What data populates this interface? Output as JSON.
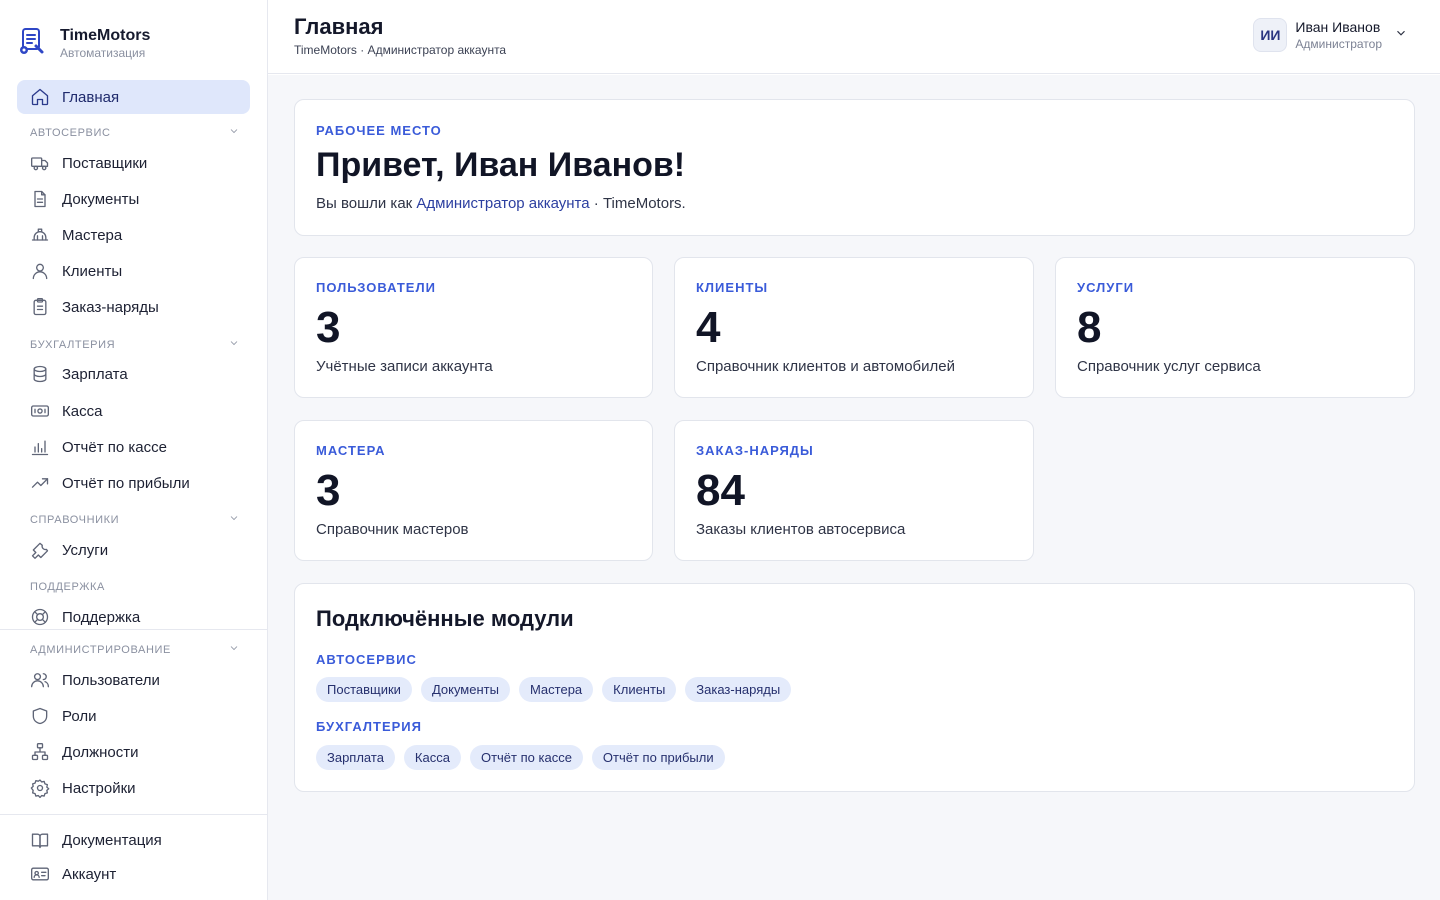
{
  "brand": {
    "title": "TimeMotors",
    "subtitle": "Автоматизация"
  },
  "sidebar": {
    "home": {
      "label": "Главная",
      "icon": "home-icon"
    },
    "sections": [
      {
        "label": "Автосервис",
        "items": [
          {
            "label": "Поставщики",
            "icon": "truck-icon"
          },
          {
            "label": "Документы",
            "icon": "document-icon"
          },
          {
            "label": "Мастера",
            "icon": "hardhat-icon"
          },
          {
            "label": "Клиенты",
            "icon": "user-icon"
          },
          {
            "label": "Заказ-наряды",
            "icon": "clipboard-icon"
          }
        ]
      },
      {
        "label": "Бухгалтерия",
        "items": [
          {
            "label": "Зарплата",
            "icon": "coins-icon"
          },
          {
            "label": "Касса",
            "icon": "banknote-icon"
          },
          {
            "label": "Отчёт по кассе",
            "icon": "bar-chart-icon"
          },
          {
            "label": "Отчёт по прибыли",
            "icon": "trending-up-icon"
          }
        ]
      },
      {
        "label": "Справочники",
        "items": [
          {
            "label": "Услуги",
            "icon": "wrench-icon"
          }
        ]
      },
      {
        "label": "Поддержка",
        "items": [
          {
            "label": "Поддержка",
            "icon": "lifebuoy-icon"
          }
        ]
      },
      {
        "label": "Администрирование",
        "items": [
          {
            "label": "Пользователи",
            "icon": "users-icon"
          },
          {
            "label": "Роли",
            "icon": "shield-icon"
          },
          {
            "label": "Должности",
            "icon": "org-chart-icon"
          },
          {
            "label": "Настройки",
            "icon": "gear-icon"
          }
        ]
      }
    ],
    "footer": [
      {
        "label": "Документация",
        "icon": "book-icon"
      },
      {
        "label": "Аккаунт",
        "icon": "id-card-icon"
      }
    ]
  },
  "header": {
    "title": "Главная",
    "subtitle": "TimeMotors · Администратор аккаунта",
    "user": {
      "initials": "ИИ",
      "name": "Иван Иванов",
      "role": "Администратор"
    }
  },
  "welcome": {
    "overline": "Рабочее место",
    "title": "Привет, Иван Иванов!",
    "text_prefix": "Вы вошли как ",
    "role_link": "Администратор аккаунта",
    "text_suffix": " · TimeMotors."
  },
  "stats": [
    {
      "label": "Пользователи",
      "value": "3",
      "desc": "Учётные записи аккаунта"
    },
    {
      "label": "Клиенты",
      "value": "4",
      "desc": "Справочник клиентов и автомобилей"
    },
    {
      "label": "Услуги",
      "value": "8",
      "desc": "Справочник услуг сервиса"
    },
    {
      "label": "Мастера",
      "value": "3",
      "desc": "Справочник мастеров"
    },
    {
      "label": "Заказ-наряды",
      "value": "84",
      "desc": "Заказы клиентов автосервиса"
    }
  ],
  "modules": {
    "title": "Подключённые модули",
    "groups": [
      {
        "label": "Автосервис",
        "chips": [
          "Поставщики",
          "Документы",
          "Мастера",
          "Клиенты",
          "Заказ-наряды"
        ]
      },
      {
        "label": "Бухгалтерия",
        "chips": [
          "Зарплата",
          "Касса",
          "Отчёт по кассе",
          "Отчёт по прибыли"
        ]
      }
    ]
  },
  "colors": {
    "accent": "#3a5bd9",
    "active_bg": "#dfe7fb",
    "chip_bg": "#e4ebfb",
    "content_bg": "#f6f7fa"
  }
}
